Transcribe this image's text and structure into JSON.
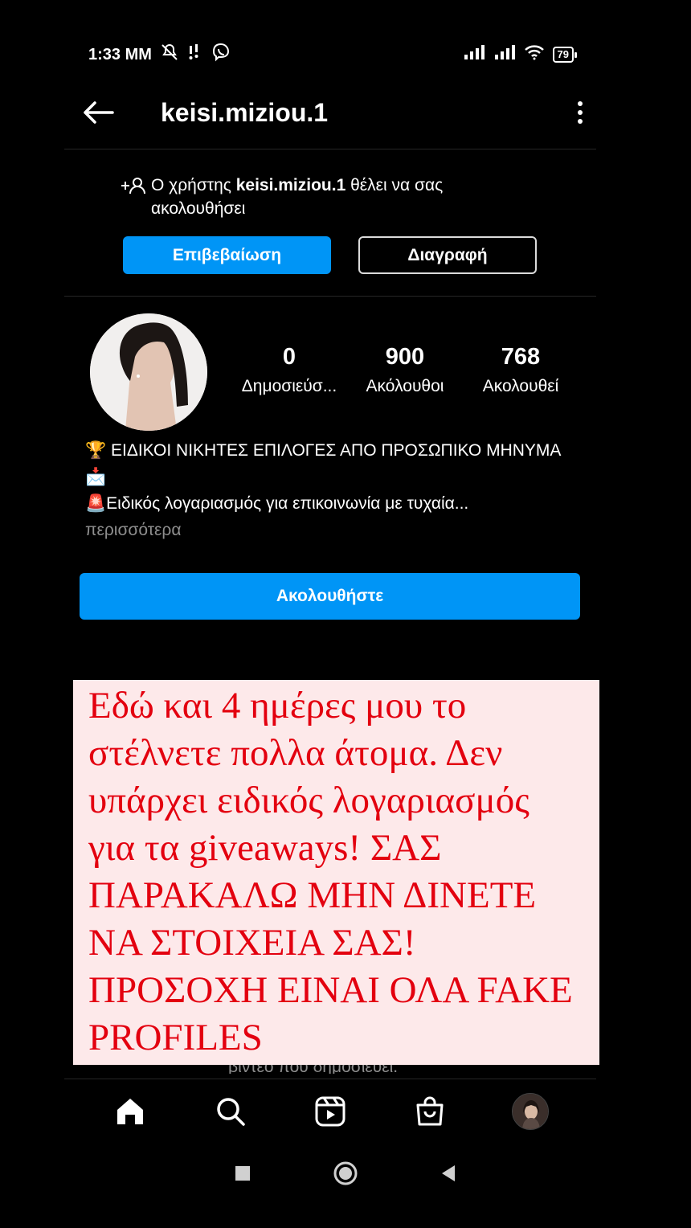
{
  "status_bar": {
    "time": "1:33 MM",
    "battery": "79",
    "icons": [
      "mute-icon",
      "signal-dots-icon",
      "viber-icon",
      "cell-signal-icon",
      "cell-signal-icon",
      "wifi-icon",
      "battery-icon"
    ]
  },
  "header": {
    "username": "keisi.miziou.1",
    "back_icon": "arrow-left-icon",
    "more_icon": "more-vertical-icon"
  },
  "follow_request": {
    "prefix": "Ο χρήστης ",
    "username": "keisi.miziou.1",
    "suffix": " θέλει να σας ακολουθήσει",
    "confirm_label": "Επιβεβαίωση",
    "delete_label": "Διαγραφή"
  },
  "profile": {
    "stats": [
      {
        "value": "0",
        "label": "Δημοσιεύσ..."
      },
      {
        "value": "900",
        "label": "Ακόλουθοι"
      },
      {
        "value": "768",
        "label": "Ακολουθεί"
      }
    ],
    "bio_line1": "🏆 ΕΙΔΙΚΟΙ ΝΙΚΗΤΕΣ ΕΠΙΛΟΓΕΣ ΑΠΟ ΠΡΟΣΩΠΙΚΟ ΜΗΝΥΜΑ 📩",
    "bio_line2": "🚨Ειδικός λογαριασμός για επικοινωνία με τυχαία...",
    "bio_more": "περισσότερα",
    "follow_label": "Ακολουθήστε"
  },
  "overlay_note": {
    "text": "Εδώ και 4 ημέρες μου το στέλνετε πολλα άτομα. Δεν υπάρχει ειδικός λογαριασμός για τα giveaways! ΣΑΣ ΠΑΡΑΚΑΛΩ ΜΗΝ ΔΙΝΕΤΕ ΝΑ ΣΤΟΙΧΕΙΑ ΣΑΣ! ΠΡΟΣΟΧΗ ΕΙΝΑΙ ΟΛΑ FAKE PROFILES",
    "partially_hidden_text": "βίντεο που δημοσιεύει.",
    "color": "#e3000f",
    "background": "#fde9ea"
  },
  "bottom_nav": [
    "home-icon",
    "search-icon",
    "reels-icon",
    "shop-icon",
    "profile-avatar"
  ],
  "system_nav": [
    "recents-square-icon",
    "home-circle-icon",
    "back-triangle-icon"
  ],
  "colors": {
    "accent": "#0095f6",
    "background": "#000000"
  }
}
